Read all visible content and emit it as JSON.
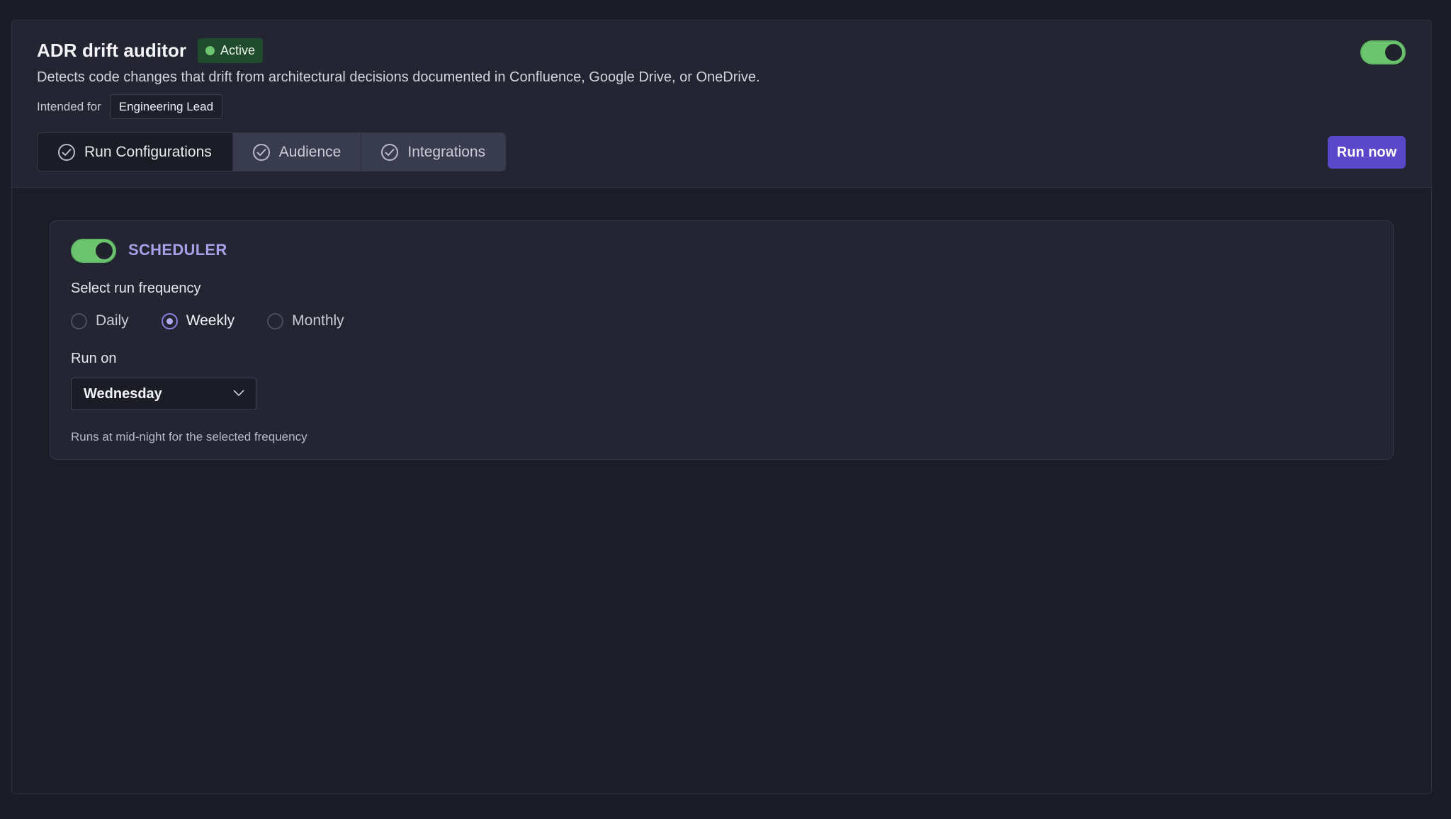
{
  "agent": {
    "title": "ADR drift auditor",
    "status": "Active",
    "description": "Detects code changes that drift from architectural decisions documented in Confluence, Google Drive, or OneDrive.",
    "intended_label": "Intended for",
    "intended_value": "Engineering Lead",
    "enabled": true
  },
  "tabs": [
    {
      "label": "Run Configurations",
      "active": true
    },
    {
      "label": "Audience",
      "active": false
    },
    {
      "label": "Integrations",
      "active": false
    }
  ],
  "run_button": "Run now",
  "scheduler": {
    "title": "SCHEDULER",
    "enabled": true,
    "frequency_label": "Select run frequency",
    "options": [
      "Daily",
      "Weekly",
      "Monthly"
    ],
    "selected": "Weekly",
    "run_on_label": "Run on",
    "run_on_value": "Wednesday",
    "hint": "Runs at mid-night for the selected frequency"
  },
  "colors": {
    "accent": "#5a48c8",
    "toggle_on": "#6cc46f",
    "section_title": "#a7a0e8",
    "badge_bg": "#1f4a2c"
  }
}
